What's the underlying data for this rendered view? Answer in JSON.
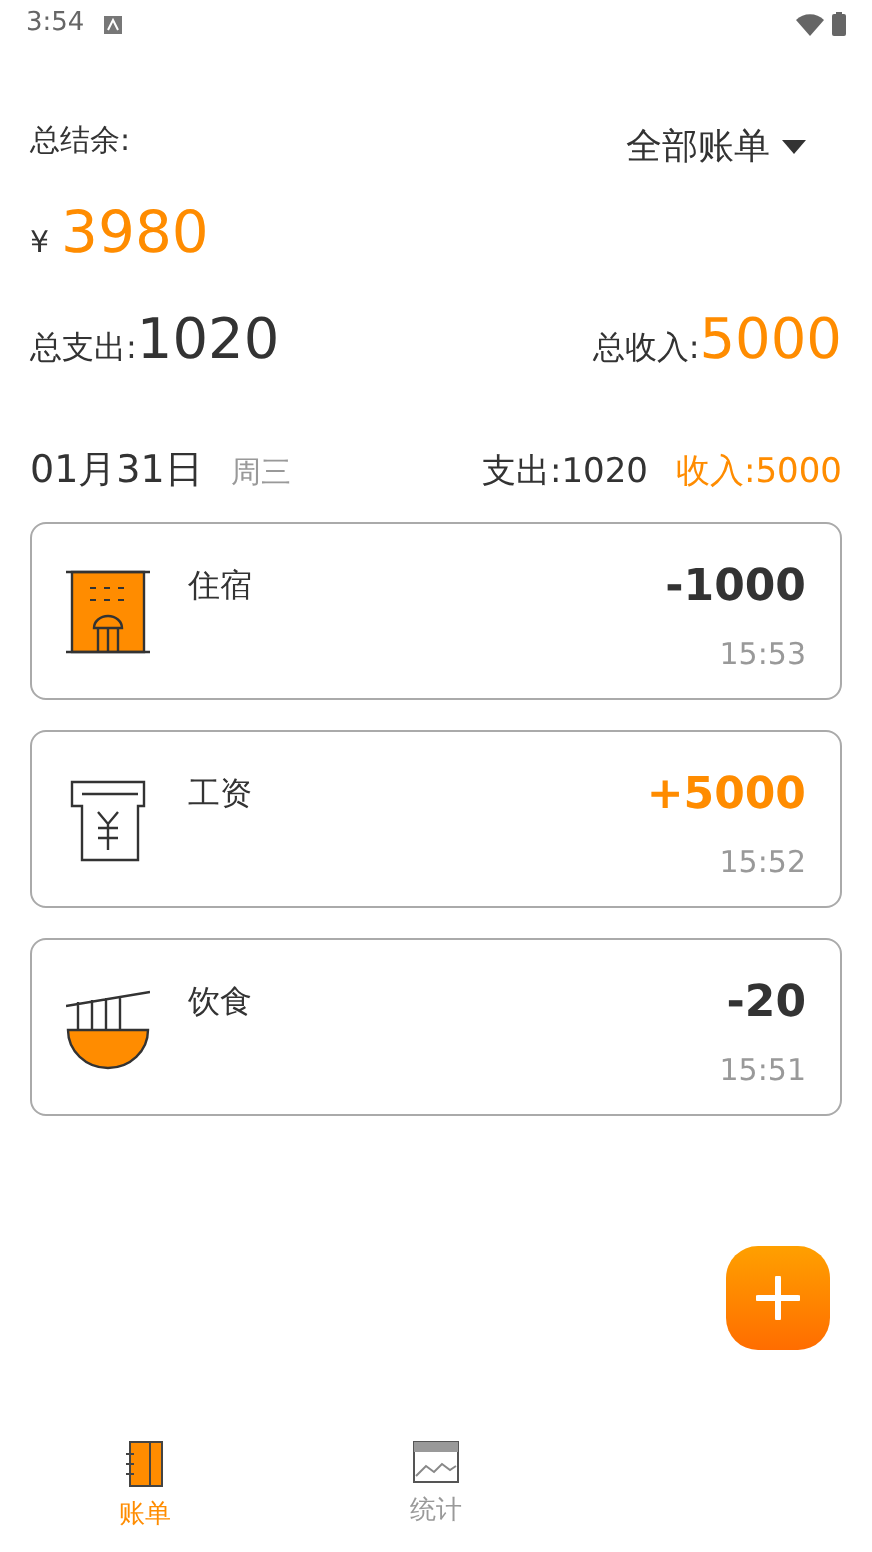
{
  "status_bar": {
    "time": "3:54"
  },
  "summary": {
    "balance_label": "总结余:",
    "filter": "全部账单",
    "currency": "¥",
    "balance": "3980",
    "expense_label": "总支出:",
    "expense": "1020",
    "income_label": "总收入:",
    "income": "5000"
  },
  "day": {
    "date": "01月31日",
    "weekday": "周三",
    "expense": "支出:1020",
    "income": "收入:5000"
  },
  "records": [
    {
      "kind": "lodging",
      "name": "住宿",
      "amount": "-1000",
      "income": false,
      "time": "15:53"
    },
    {
      "kind": "salary",
      "name": "工资",
      "amount": "+5000",
      "income": true,
      "time": "15:52"
    },
    {
      "kind": "food",
      "name": "饮食",
      "amount": "-20",
      "income": false,
      "time": "15:51"
    }
  ],
  "tabs": [
    {
      "kind": "bills",
      "label": "账单",
      "selected": true
    },
    {
      "kind": "stats",
      "label": "统计",
      "selected": false
    }
  ]
}
